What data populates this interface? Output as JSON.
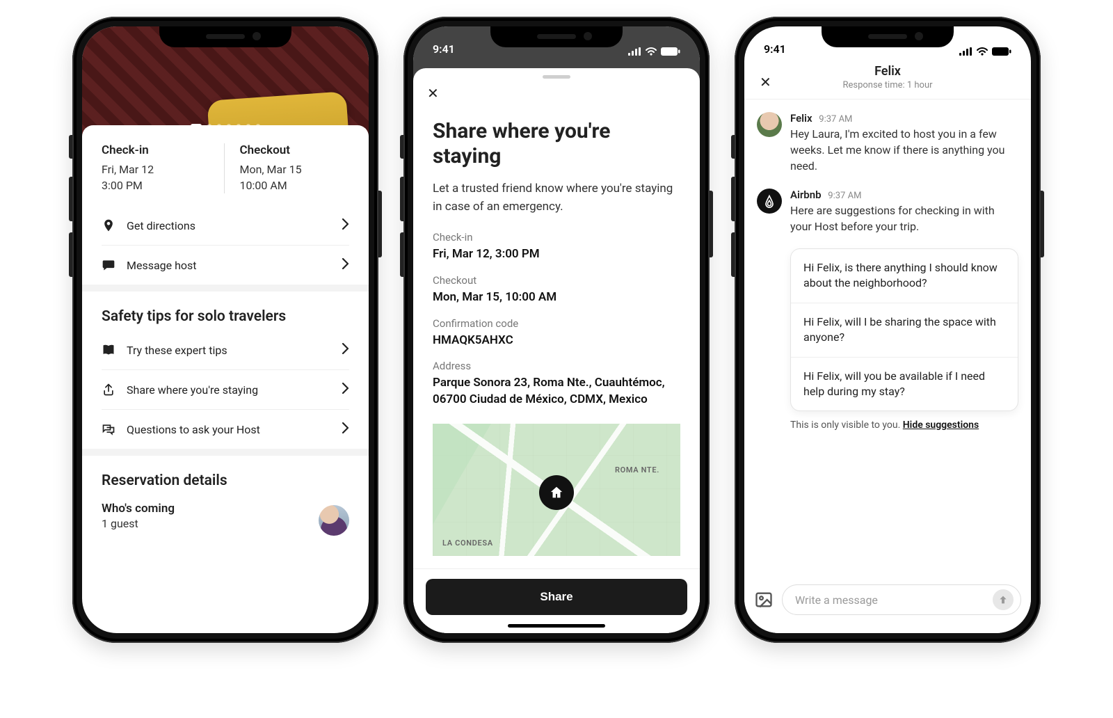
{
  "status": {
    "time": "9:41"
  },
  "phone1": {
    "checkin": {
      "label": "Check-in",
      "date": "Fri, Mar 12",
      "time": "3:00 PM"
    },
    "checkout": {
      "label": "Checkout",
      "date": "Mon, Mar 15",
      "time": "10:00 AM"
    },
    "actions": {
      "directions": "Get directions",
      "message_host": "Message host"
    },
    "safety": {
      "title": "Safety tips for solo travelers",
      "items": {
        "tips": "Try these expert tips",
        "share": "Share where you're staying",
        "qs": "Questions to ask your Host"
      }
    },
    "reservation": {
      "title": "Reservation details",
      "who_label": "Who's coming",
      "who_value": "1 guest"
    }
  },
  "phone2": {
    "title": "Share where you're staying",
    "lead": "Let a trusted friend know where you're staying in case of an emergency.",
    "checkin": {
      "label": "Check-in",
      "value": "Fri, Mar 12, 3:00 PM"
    },
    "checkout": {
      "label": "Checkout",
      "value": "Mon, Mar 15, 10:00 AM"
    },
    "conf": {
      "label": "Confirmation code",
      "value": "HMAQK5AHXC"
    },
    "addr": {
      "label": "Address",
      "value": "Parque Sonora 23, Roma Nte., Cuauhtémoc, 06700 Ciudad de México, CDMX, Mexico"
    },
    "map": {
      "label1": "ROMA NTE.",
      "label2": "LA CONDESA"
    },
    "share_button": "Share"
  },
  "phone3": {
    "header": {
      "name": "Felix",
      "subtitle": "Response time: 1 hour"
    },
    "msg1": {
      "name": "Felix",
      "time": "9:37 AM",
      "text": "Hey Laura, I'm excited to host you in a few weeks. Let me know if there is anything you need."
    },
    "msg2": {
      "name": "Airbnb",
      "time": "9:37 AM",
      "text": "Here are suggestions for checking in with your Host before your trip."
    },
    "suggestions": {
      "s1": "Hi Felix, is there anything I should know about the neighborhood?",
      "s2": "Hi Felix, will I be sharing the space with anyone?",
      "s3": "Hi Felix, will you be available if I need help during my stay?"
    },
    "hint": {
      "text": "This is only visible to you. ",
      "link": "Hide suggestions"
    },
    "compose_placeholder": "Write a message"
  }
}
